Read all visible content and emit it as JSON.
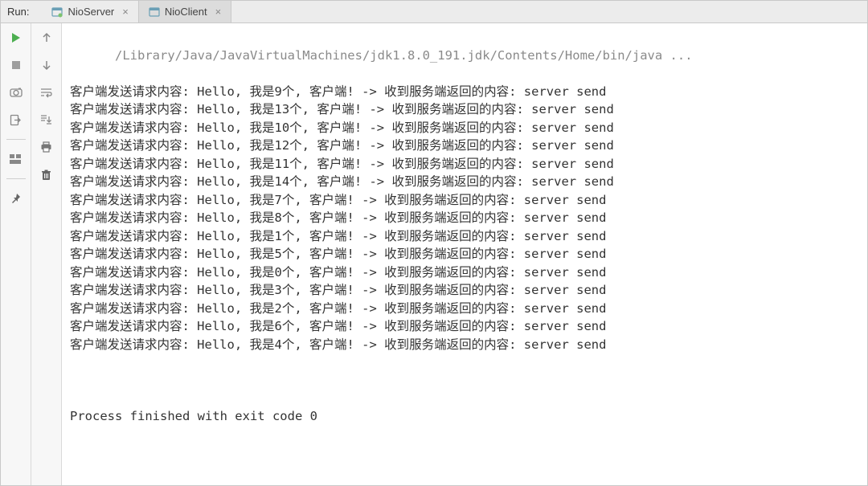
{
  "header": {
    "run_label": "Run:"
  },
  "tabs": [
    {
      "label": "NioServer",
      "active": false
    },
    {
      "label": "NioClient",
      "active": true
    }
  ],
  "toolbar_left": {
    "rerun": "rerun-icon",
    "stop": "stop-icon",
    "dump": "camera-icon",
    "exit": "exit-icon",
    "layout": "layout-icon",
    "pin": "pin-icon"
  },
  "toolbar_right": {
    "up": "arrow-up-icon",
    "down": "arrow-down-icon",
    "wrap": "soft-wrap-icon",
    "scroll": "scroll-to-end-icon",
    "print": "print-icon",
    "trash": "trash-icon"
  },
  "console": {
    "cmd": "/Library/Java/JavaVirtualMachines/jdk1.8.0_191.jdk/Contents/Home/bin/java ...",
    "lines": [
      "客户端发送请求内容: Hello, 我是9个, 客户端! -> 收到服务端返回的内容: server send",
      "客户端发送请求内容: Hello, 我是13个, 客户端! -> 收到服务端返回的内容: server send",
      "客户端发送请求内容: Hello, 我是10个, 客户端! -> 收到服务端返回的内容: server send",
      "客户端发送请求内容: Hello, 我是12个, 客户端! -> 收到服务端返回的内容: server send",
      "客户端发送请求内容: Hello, 我是11个, 客户端! -> 收到服务端返回的内容: server send",
      "客户端发送请求内容: Hello, 我是14个, 客户端! -> 收到服务端返回的内容: server send",
      "客户端发送请求内容: Hello, 我是7个, 客户端! -> 收到服务端返回的内容: server send",
      "客户端发送请求内容: Hello, 我是8个, 客户端! -> 收到服务端返回的内容: server send",
      "客户端发送请求内容: Hello, 我是1个, 客户端! -> 收到服务端返回的内容: server send",
      "客户端发送请求内容: Hello, 我是5个, 客户端! -> 收到服务端返回的内容: server send",
      "客户端发送请求内容: Hello, 我是0个, 客户端! -> 收到服务端返回的内容: server send",
      "客户端发送请求内容: Hello, 我是3个, 客户端! -> 收到服务端返回的内容: server send",
      "客户端发送请求内容: Hello, 我是2个, 客户端! -> 收到服务端返回的内容: server send",
      "客户端发送请求内容: Hello, 我是6个, 客户端! -> 收到服务端返回的内容: server send",
      "客户端发送请求内容: Hello, 我是4个, 客户端! -> 收到服务端返回的内容: server send"
    ],
    "exit": "Process finished with exit code 0"
  }
}
